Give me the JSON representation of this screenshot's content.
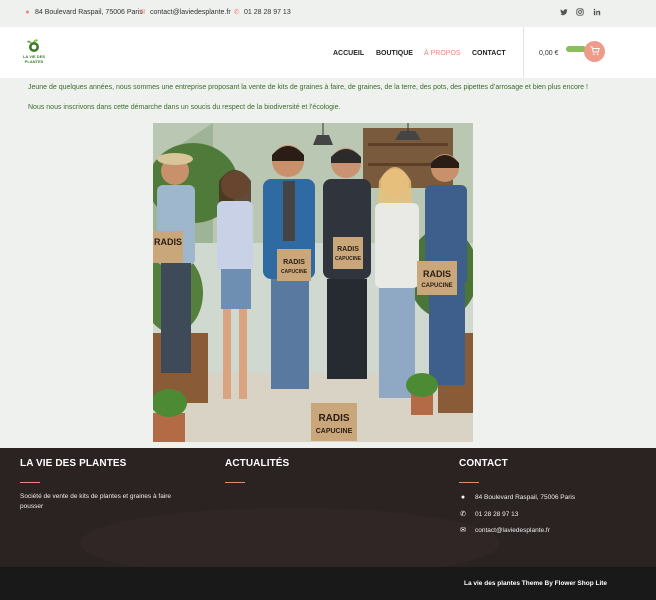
{
  "topbar": {
    "address": "84 Boulevard Raspail, 75006 Paris",
    "email": "contact@laviedesplante.fr",
    "phone": "01 28 28 97 13",
    "social_icons": [
      "twitter-icon",
      "instagram-icon",
      "linkedin-icon"
    ]
  },
  "header": {
    "logo_text": "LA VIE DES PLANTES",
    "nav": [
      {
        "label": "ACCUEIL",
        "active": false
      },
      {
        "label": "BOUTIQUE",
        "active": false
      },
      {
        "label": "À PROPOS",
        "active": true
      },
      {
        "label": "CONTACT",
        "active": false
      }
    ],
    "cart_total": "0,00 €"
  },
  "content": {
    "paragraph_1": "Jeune de quelques années, nous sommes une entreprise proposant la vente de kits de graines à faire, de graines, de la terre, des pots, des pipettes d’arrosage et bien plus encore !",
    "paragraph_2": "Nous nous inscrivons dans cette démarche dans un soucis du respect de la biodiversité et l’écologie.",
    "photo_box_label": "RADIS CAPUCINE"
  },
  "footer": {
    "col1_title": "LA VIE DES PLANTES",
    "col1_text": "Société de vente de kits de plantes et graines à faire pousser",
    "col2_title": "ACTUALITÉS",
    "col3_title": "CONTACT",
    "address": "84 Boulevard Raspail, 75006 Paris",
    "phone": "01 28 28 97 13",
    "email": "contact@laviedesplante.fr",
    "credit": "La vie des plantes Theme By Flower Shop Lite"
  },
  "colors": {
    "accent": "#e8877a",
    "green_text": "#3a6b2c",
    "footer_bg": "#2b2222",
    "bottom_bg": "#191919"
  }
}
